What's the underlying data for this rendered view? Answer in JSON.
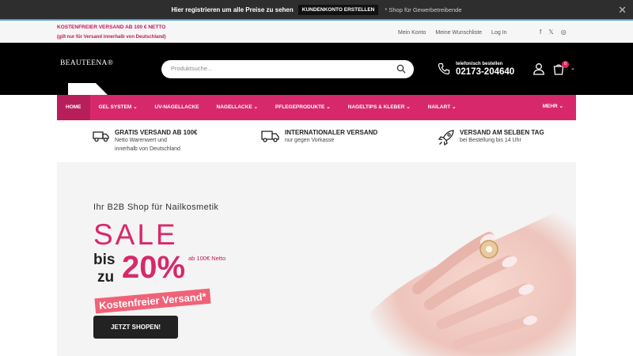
{
  "topbar": {
    "register_text": "Hier registrieren um alle Preise zu sehen",
    "account_button": "KUNDENKONTO ERSTELLEN",
    "note": "* Shop für Gewerbetreibende",
    "close": "✕"
  },
  "infobar": {
    "shipping_line1": "KOSTENFREIER VERSAND AB 100 € NETTO",
    "shipping_line2": "(gilt nur für Versand innerhalb von Deutschland)",
    "links": [
      "Mein Konto",
      "Meine Wunschliste",
      "Log In"
    ],
    "social": [
      "f",
      "𝕏",
      "◎"
    ]
  },
  "header": {
    "logo": "BEAUTEENA®",
    "search_placeholder": "Produktsuche...",
    "phone_label": "telefonisch bestellen",
    "phone_number": "02173-204640",
    "cart_count": "0"
  },
  "nav": {
    "items": [
      "HOME",
      "GEL SYSTEM ⌄",
      "UV-NAGELLACKE",
      "NAGELLACKE ⌄",
      "PFLEGEPRODUKTE ⌄",
      "NAGELTIPS & KLEBER ⌄",
      "NAILART ⌄"
    ],
    "more": "MEHR ⌄"
  },
  "usps": [
    {
      "title": "GRATIS VERSAND AB 100€",
      "line1": "Netto Warenwert und",
      "line2": "innerhalb von Deutschland",
      "icon": "truck-icon"
    },
    {
      "title": "INTERNATIONALER VERSAND",
      "line1": "nur gegen Vorkasse",
      "line2": "",
      "icon": "delivery-truck-icon"
    },
    {
      "title": "VERSAND AM SELBEN TAG",
      "line1": "bei Bestellung bis 14 Uhr",
      "line2": "",
      "icon": "rocket-icon"
    }
  ],
  "hero": {
    "subtitle": "Ihr B2B Shop für Nailkosmetik",
    "sale": "SALE",
    "bis": "bis",
    "zu": "zu",
    "percent": "20%",
    "netto_note": "ab 100€ Netto",
    "ribbon": "Kostenfreier Versand*",
    "button": "JETZT SHOPEN!"
  },
  "colors": {
    "accent": "#d8286c",
    "header_bg": "#000000",
    "topbar_bg": "#2e2e2e"
  }
}
